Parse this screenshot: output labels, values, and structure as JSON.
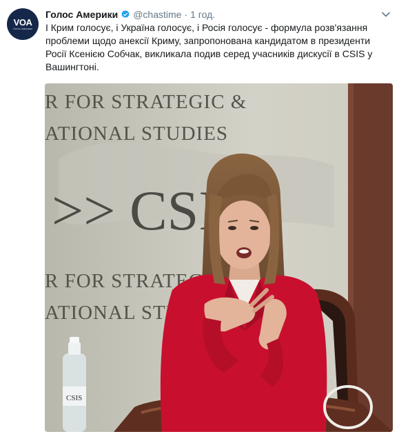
{
  "account": {
    "display_name": "Голос Америки",
    "handle": "@chastime",
    "separator": "·",
    "time": "1 год.",
    "avatar_text": "VOA",
    "avatar_subtext": "Голос Америки"
  },
  "tweet": {
    "text": "І Крим голосує, і Україна голосує, і Росія голосує - формула розв'язання проблеми щодо анексії Криму, запропонована кандидатом в президенти Росії Ксенією Собчак, викликала подив серед учасників дискусії в CSIS у Вашингтоні."
  },
  "media": {
    "backdrop_line1": "R FOR STRATEGIC &",
    "backdrop_line2": "ATIONAL STUDIES",
    "backdrop_logo": ">> CSIS",
    "backdrop_line3": "R FOR STRATEG",
    "backdrop_line4": "ATIONAL STUDI",
    "bottle_label": "CSIS"
  },
  "icons": {
    "verified": "verified-badge-icon",
    "caret": "chevron-down-icon"
  },
  "colors": {
    "verified": "#1da1f2",
    "secondary_text": "#657786",
    "avatar_bg": "#15284a",
    "jacket": "#c8102e"
  }
}
